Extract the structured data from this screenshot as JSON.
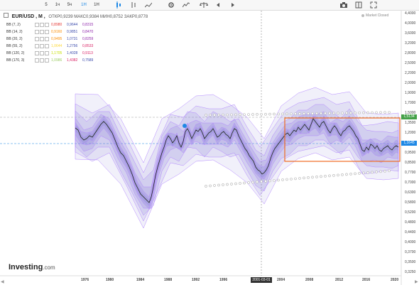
{
  "toolbar": {
    "intervals": [
      "5",
      "1ч",
      "5ч",
      "1Н",
      "1Н"
    ],
    "active_interval_index": 3,
    "icons": [
      "candlestick-icon",
      "bar-chart-icon",
      "line-chart-icon",
      "settings-icon",
      "indicator-icon",
      "balance-icon",
      "undo-icon",
      "redo-icon",
      "camera-icon",
      "layout-icon",
      "fullscreen-icon"
    ]
  },
  "symbol": {
    "name": "EUR/USD , M ,",
    "ohlc": "ОТКР0,9239  МАКС0,9384  МИН0,8752  ЗАКР0,8778"
  },
  "market_status": "Market Closed",
  "indicators": [
    {
      "label": "BB (7, 2)",
      "values": [
        "0,8980",
        "0,9644",
        "0,8315"
      ],
      "colors": [
        "#e53935",
        "#3949ab",
        "#8e24aa"
      ]
    },
    {
      "label": "BB (14, 2)",
      "values": [
        "0,9160",
        "0,9851",
        "0,8470"
      ],
      "colors": [
        "#fb8c00",
        "#3949ab",
        "#8e24aa"
      ]
    },
    {
      "label": "BB (20, 2)",
      "values": [
        "0,9495",
        "1,0731",
        "0,8259"
      ],
      "colors": [
        "#fb8c00",
        "#3949ab",
        "#8e24aa"
      ]
    },
    {
      "label": "BB (55, 2)",
      "values": [
        "1,0644",
        "1,2756",
        "0,8533"
      ],
      "colors": [
        "#fdd835",
        "#3949ab",
        "#d81b60"
      ]
    },
    {
      "label": "BB (120, 2)",
      "values": [
        "1,1705",
        "1,4028",
        "0,9113"
      ],
      "colors": [
        "#c6e000",
        "#3949ab",
        "#d81b60"
      ]
    },
    {
      "label": "BB (170, 3)",
      "values": [
        "1,0986",
        "1,4382",
        "0,7589"
      ],
      "colors": [
        "#9ccc65",
        "#d81b60",
        "#3949ab"
      ]
    }
  ],
  "y_axis_ticks": [
    "4,4000",
    "4,0000",
    "3,6000",
    "3,2000",
    "2,8000",
    "2,5000",
    "2,2000",
    "2,0000",
    "1,9000",
    "1,7000",
    "1,5000",
    "1,3500",
    "1,2000",
    "1,0500",
    "0,9500",
    "0,8500",
    "0,7700",
    "0,7000",
    "0,6300",
    "0,5800",
    "0,5200",
    "0,4800",
    "0,4400",
    "0,4000",
    "0,3700",
    "0,3500",
    "0,3250"
  ],
  "price_tags": [
    {
      "value": "1,5134",
      "color": "#43a047"
    },
    {
      "value": "1,1645",
      "color": "#1e88e5"
    }
  ],
  "x_axis_ticks": [
    "1976",
    "1980",
    "1984",
    "1988",
    "1992",
    "1996",
    "2001-03-01",
    "2004",
    "2008",
    "2012",
    "2016",
    "2020"
  ],
  "crosshair_date": "2001-03-01",
  "logo": {
    "brand": "Investing",
    "suffix": ".com"
  },
  "colors": {
    "accent": "#1e88e5",
    "band_fill": "#8c86d8",
    "price": "#222222",
    "box": "#ef6c21",
    "ring": "#bdbdbd"
  }
}
